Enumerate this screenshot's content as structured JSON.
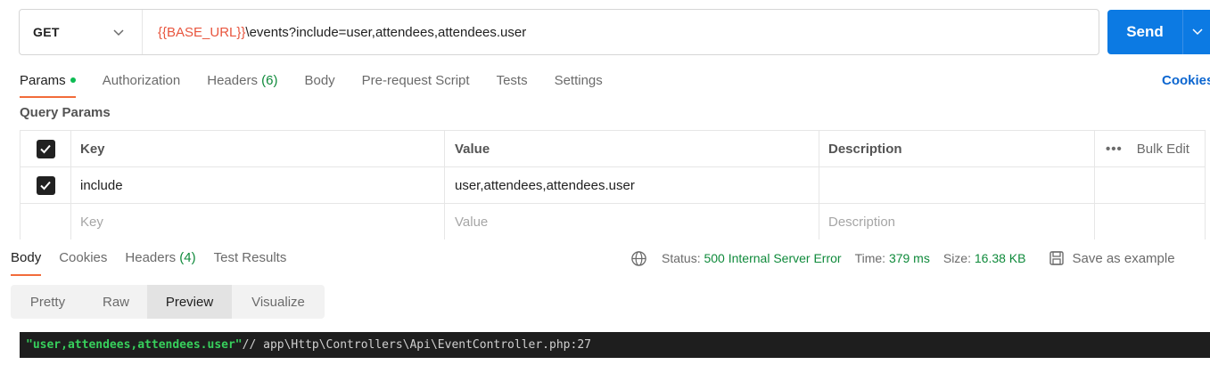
{
  "request": {
    "method": "GET",
    "url_variable": "{{BASE_URL}}",
    "url_path": "\\events?include=user,attendees,attendees.user",
    "send_label": "Send"
  },
  "tabs": [
    {
      "label": "Params",
      "count": ""
    },
    {
      "label": "Authorization",
      "count": ""
    },
    {
      "label": "Headers",
      "count": "(6)"
    },
    {
      "label": "Body",
      "count": ""
    },
    {
      "label": "Pre-request Script",
      "count": ""
    },
    {
      "label": "Tests",
      "count": ""
    },
    {
      "label": "Settings",
      "count": ""
    }
  ],
  "cookies_link": "Cookies",
  "query_params": {
    "title": "Query Params",
    "headers": {
      "key": "Key",
      "value": "Value",
      "description": "Description",
      "bulk_edit": "Bulk Edit"
    },
    "row": {
      "key": "include",
      "value": "user,attendees,attendees.user",
      "description": ""
    },
    "placeholders": {
      "key": "Key",
      "value": "Value",
      "description": "Description"
    }
  },
  "response": {
    "tabs": [
      {
        "label": "Body",
        "count": ""
      },
      {
        "label": "Cookies",
        "count": ""
      },
      {
        "label": "Headers",
        "count": "(4)"
      },
      {
        "label": "Test Results",
        "count": ""
      }
    ],
    "status_label": "Status:",
    "status_value": "500 Internal Server Error",
    "time_label": "Time:",
    "time_value": "379 ms",
    "size_label": "Size:",
    "size_value": "16.38 KB",
    "save_example": "Save as example",
    "formats": [
      "Pretty",
      "Raw",
      "Preview",
      "Visualize"
    ],
    "preview_string": "\"user,attendees,attendees.user\"",
    "preview_comment": " // app\\Http\\Controllers\\Api\\EventController.php:27"
  },
  "colors": {
    "send": "#0c7ae3",
    "status_ok": "#0f8a3b",
    "url_var": "#e8553e",
    "tab_accent": "#f26b3a"
  }
}
